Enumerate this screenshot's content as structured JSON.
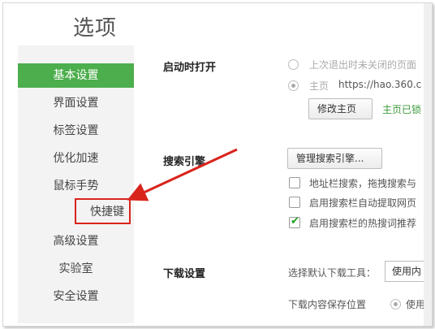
{
  "dialog": {
    "title": "选项"
  },
  "sidebar": {
    "items": [
      {
        "label": "基本设置",
        "active": true
      },
      {
        "label": "界面设置"
      },
      {
        "label": "标签设置"
      },
      {
        "label": "优化加速"
      },
      {
        "label": "鼠标手势"
      },
      {
        "label": "快捷键",
        "highlighted": true
      },
      {
        "label": "高级设置"
      },
      {
        "label": "实验室"
      },
      {
        "label": "安全设置"
      }
    ]
  },
  "startup": {
    "label": "启动时打开",
    "option_last_session": "上次退出时未关闭的页面",
    "option_homepage_prefix": "主页",
    "homepage_url": "https://hao.360.c",
    "change_homepage_button": "修改主页",
    "homepage_locked_text": "主页已锁"
  },
  "search": {
    "label": "搜索引擎",
    "manage_button": "管理搜索引擎...",
    "options": [
      {
        "label": "地址栏搜索，拖拽搜索与",
        "checked": false
      },
      {
        "label": "启用搜索栏自动提取网页",
        "checked": false
      },
      {
        "label": "启用搜索栏的热搜词推荐",
        "checked": true
      }
    ]
  },
  "download": {
    "label": "下载设置",
    "choose_tool_label": "选择默认下载工具：",
    "tool_select_value": "使用内",
    "content_row_text": "下载内容保存位置",
    "content_row_suffix": "使用"
  },
  "colors": {
    "accent": "#4cae4c",
    "annotation": "#d9241c"
  }
}
